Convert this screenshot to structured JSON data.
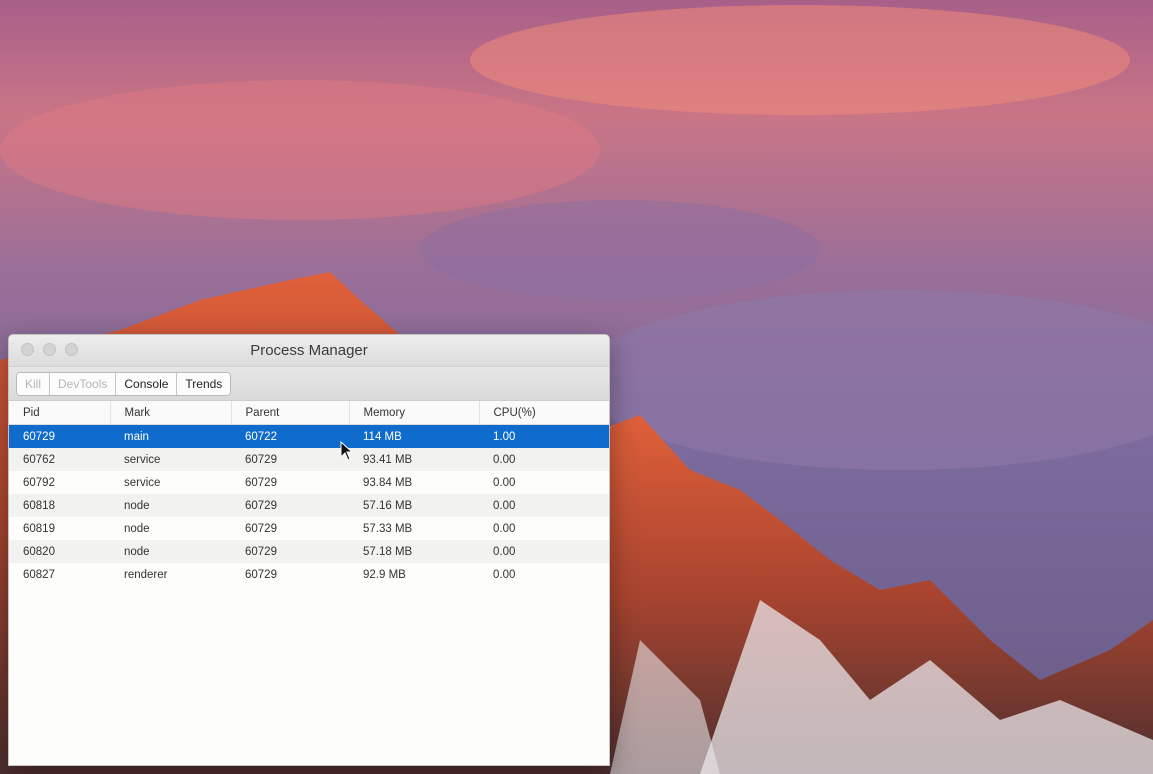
{
  "window": {
    "title": "Process Manager"
  },
  "toolbar": {
    "buttons": [
      {
        "label": "Kill",
        "enabled": false
      },
      {
        "label": "DevTools",
        "enabled": false
      },
      {
        "label": "Console",
        "enabled": true
      },
      {
        "label": "Trends",
        "enabled": true
      }
    ]
  },
  "table": {
    "columns": [
      "Pid",
      "Mark",
      "Parent",
      "Memory",
      "CPU(%)"
    ],
    "selected_row": 0,
    "rows": [
      [
        "60729",
        "main",
        "60722",
        "114 MB",
        "1.00"
      ],
      [
        "60762",
        "service",
        "60729",
        "93.41 MB",
        "0.00"
      ],
      [
        "60792",
        "service",
        "60729",
        "93.84 MB",
        "0.00"
      ],
      [
        "60818",
        "node",
        "60729",
        "57.16 MB",
        "0.00"
      ],
      [
        "60819",
        "node",
        "60729",
        "57.33 MB",
        "0.00"
      ],
      [
        "60820",
        "node",
        "60729",
        "57.18 MB",
        "0.00"
      ],
      [
        "60827",
        "renderer",
        "60729",
        "92.9 MB",
        "0.00"
      ]
    ]
  },
  "colors": {
    "selection": "#0f6ccc"
  },
  "icons": [
    "close-window-icon",
    "minimize-window-icon",
    "zoom-window-icon",
    "mouse-cursor-icon"
  ]
}
